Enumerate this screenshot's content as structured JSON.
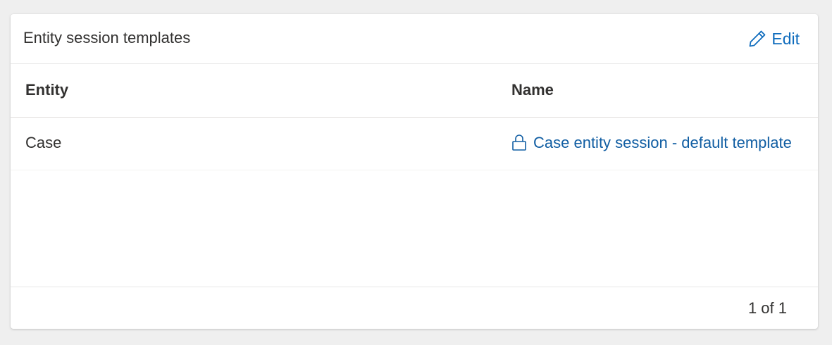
{
  "card": {
    "title": "Entity session templates",
    "edit_label": "Edit"
  },
  "table": {
    "columns": [
      "Entity",
      "Name"
    ],
    "rows": [
      {
        "entity": "Case",
        "name": "Case entity session - default template",
        "locked": true
      }
    ]
  },
  "footer": {
    "pager_text": "1 of 1"
  },
  "icons": {
    "edit": "pencil-icon",
    "lock": "lock-icon"
  },
  "colors": {
    "link": "#0f6cbd",
    "text": "#323130"
  }
}
